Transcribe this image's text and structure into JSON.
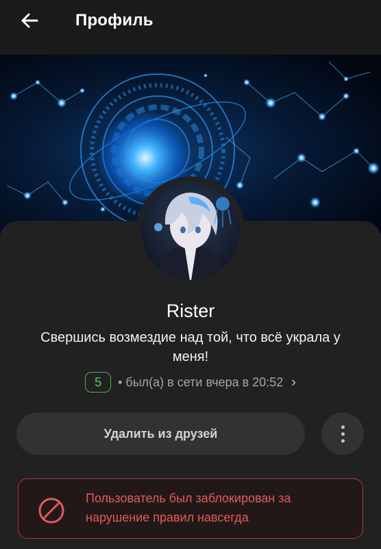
{
  "header": {
    "title": "Профиль",
    "back_icon": "arrow-left-icon"
  },
  "profile": {
    "name": "Rister",
    "status_text": "Свершись возмездие над той, что всё украла у меня!",
    "level": "5",
    "last_seen": "• был(а) в сети вчера в 20:52",
    "chevron": "›"
  },
  "actions": {
    "remove_friend_label": "Удалить из друзей",
    "more_icon": "more-vertical-icon"
  },
  "ban_notice": {
    "icon": "prohibited-icon",
    "text": "Пользователь был заблокирован за нарушение правил навсегда"
  },
  "colors": {
    "background": "#181818",
    "card": "#212121",
    "button": "#323232",
    "level_green": "#5ccb5f",
    "ban_red": "#e35a5a",
    "ban_border": "#a63a3a",
    "banner_blue": "#1e90ff"
  }
}
